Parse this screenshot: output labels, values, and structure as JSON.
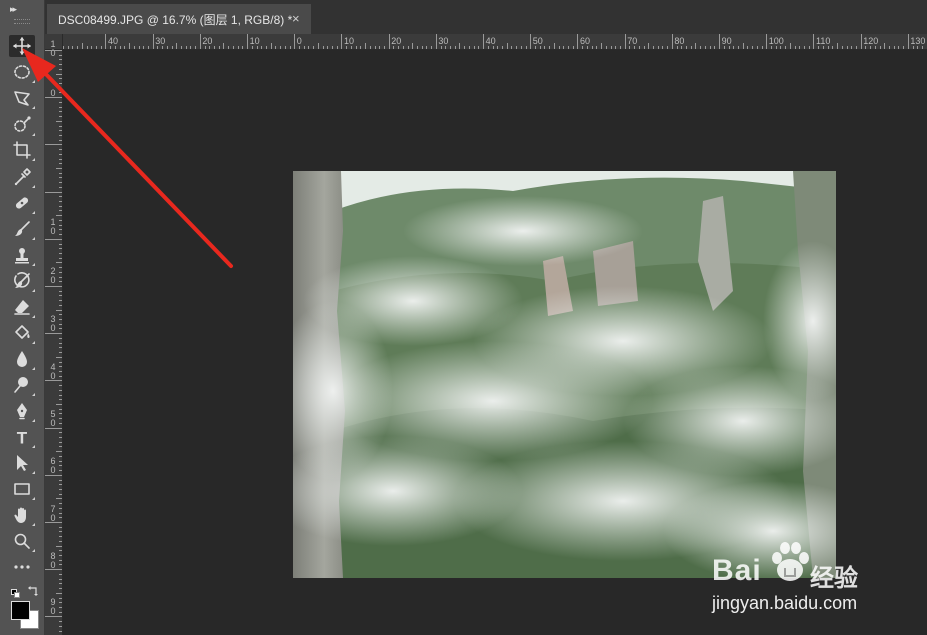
{
  "document_tab": {
    "title": "DSC08499.JPG @ 16.7% (图层 1, RGB/8) *",
    "close_glyph": "×"
  },
  "toolbar": {
    "collapse_glyph": "▸▸",
    "tools": [
      {
        "name": "move-tool",
        "icon": "move-icon",
        "active": true
      },
      {
        "name": "elliptical-marquee-tool",
        "icon": "ellipse-marquee-icon"
      },
      {
        "name": "lasso-tool",
        "icon": "polygonal-lasso-icon"
      },
      {
        "name": "quick-selection-tool",
        "icon": "quick-selection-icon"
      },
      {
        "name": "crop-tool",
        "icon": "crop-icon"
      },
      {
        "name": "eyedropper-tool",
        "icon": "eyedropper-icon"
      },
      {
        "name": "healing-brush-tool",
        "icon": "bandage-icon"
      },
      {
        "name": "brush-tool",
        "icon": "brush-icon"
      },
      {
        "name": "clone-stamp-tool",
        "icon": "stamp-icon"
      },
      {
        "name": "history-brush-tool",
        "icon": "history-brush-icon"
      },
      {
        "name": "eraser-tool",
        "icon": "eraser-icon"
      },
      {
        "name": "paint-bucket-tool",
        "icon": "paint-bucket-icon"
      },
      {
        "name": "blur-tool",
        "icon": "water-drop-icon"
      },
      {
        "name": "dodge-tool",
        "icon": "dodge-icon"
      },
      {
        "name": "pen-tool",
        "icon": "pen-icon"
      },
      {
        "name": "type-tool",
        "icon": "type-icon",
        "label": "T"
      },
      {
        "name": "path-selection-tool",
        "icon": "arrow-cursor-icon"
      },
      {
        "name": "rectangle-tool",
        "icon": "rectangle-icon"
      },
      {
        "name": "hand-tool",
        "icon": "hand-icon"
      },
      {
        "name": "zoom-tool",
        "icon": "magnifier-icon"
      },
      {
        "name": "edit-toolbar",
        "icon": "more-icon",
        "label": "•••"
      }
    ],
    "foreground_color": "#000000",
    "background_color": "#ffffff"
  },
  "horizontal_ruler": {
    "labels": [
      "40",
      "30",
      "20",
      "10",
      "0",
      "10",
      "20",
      "30",
      "40",
      "50",
      "60",
      "70",
      "80",
      "90",
      "100",
      "110",
      "120",
      "130"
    ]
  },
  "vertical_ruler": {
    "labels": [
      [
        "1",
        "0"
      ],
      [
        "0"
      ],
      [
        "1",
        "0"
      ],
      [
        "2",
        "0"
      ],
      [
        "3",
        "0"
      ],
      [
        "4",
        "0"
      ],
      [
        "5",
        "0"
      ],
      [
        "6",
        "0"
      ],
      [
        "7",
        "0"
      ],
      [
        "8",
        "0"
      ],
      [
        "9",
        "0"
      ]
    ]
  },
  "watermark": {
    "brand": "Bai",
    "brand_suffix": "经验",
    "url": "jingyan.baidu.com"
  },
  "colors": {
    "annotation_arrow": "#e8281e",
    "toolbar_bg": "#535353",
    "workspace_bg": "#282828"
  }
}
